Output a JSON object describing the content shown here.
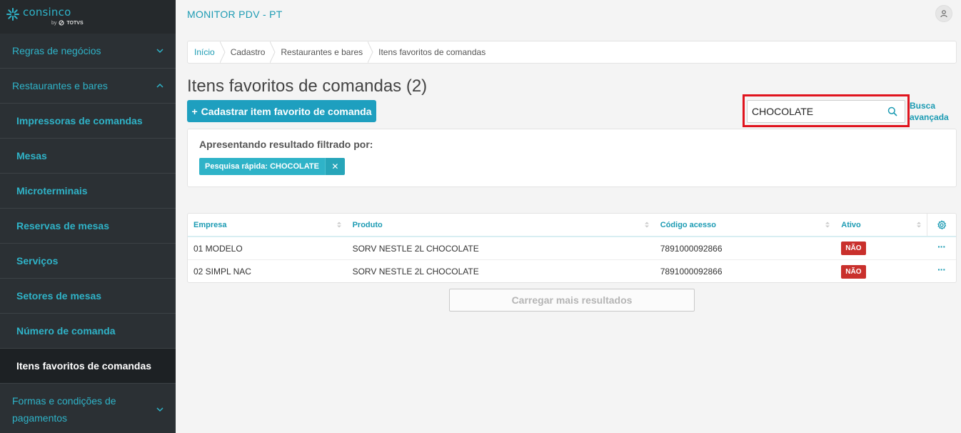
{
  "brand": {
    "name": "consinco",
    "by": "by",
    "parent": "TOTVS"
  },
  "sidebar": {
    "items": [
      {
        "label": "Regras de negócios",
        "type": "group",
        "expanded": false
      },
      {
        "label": "Restaurantes e bares",
        "type": "group",
        "expanded": true
      },
      {
        "label": "Impressoras de comandas",
        "type": "sub"
      },
      {
        "label": "Mesas",
        "type": "sub"
      },
      {
        "label": "Microterminais",
        "type": "sub"
      },
      {
        "label": "Reservas de mesas",
        "type": "sub"
      },
      {
        "label": "Serviços",
        "type": "sub"
      },
      {
        "label": "Setores de mesas",
        "type": "sub"
      },
      {
        "label": "Número de comanda",
        "type": "sub"
      },
      {
        "label": "Itens favoritos de comandas",
        "type": "sub",
        "active": true
      },
      {
        "label": "Formas e condições de pagamentos",
        "type": "group",
        "expanded": false
      }
    ]
  },
  "header": {
    "app_title": "MONITOR PDV - PT"
  },
  "breadcrumb": [
    "Início",
    "Cadastro",
    "Restaurantes e bares",
    "Itens favoritos de comandas"
  ],
  "page": {
    "title": "Itens favoritos de comandas (2)",
    "add_button": "Cadastrar item favorito de comanda",
    "add_icon": "+"
  },
  "search": {
    "value": "CHOCOLATE",
    "advanced_line1": "Busca",
    "advanced_line2": "avançada"
  },
  "filter": {
    "title": "Apresentando resultado filtrado por:",
    "chip": "Pesquisa rápida: CHOCOLATE",
    "chip_close": "✕"
  },
  "table": {
    "columns": [
      "Empresa",
      "Produto",
      "Código acesso",
      "Ativo"
    ],
    "rows": [
      {
        "empresa": "01 MODELO",
        "produto": "SORV NESTLE 2L CHOCOLATE",
        "codigo": "7891000092866",
        "ativo": "NÃO"
      },
      {
        "empresa": "02 SIMPL NAC",
        "produto": "SORV NESTLE 2L CHOCOLATE",
        "codigo": "7891000092866",
        "ativo": "NÃO"
      }
    ],
    "row_actions": "···"
  },
  "load_more": "Carregar mais resultados",
  "colors": {
    "accent": "#1c9bb3",
    "sidebar_bg": "#2b3034",
    "danger": "#c9302c",
    "highlight": "#e0141e"
  }
}
